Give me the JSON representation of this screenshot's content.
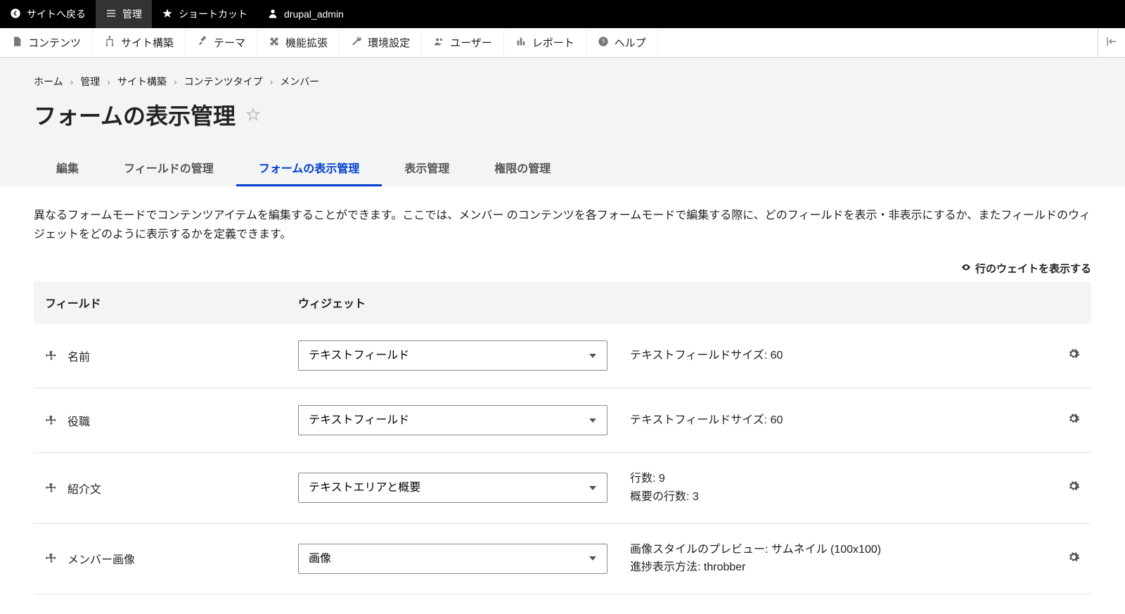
{
  "topbar": {
    "back_to_site": "サイトへ戻る",
    "manage": "管理",
    "shortcuts": "ショートカット",
    "user": "drupal_admin"
  },
  "toolbar": {
    "content": "コンテンツ",
    "structure": "サイト構築",
    "appearance": "テーマ",
    "extend": "機能拡張",
    "configuration": "環境設定",
    "people": "ユーザー",
    "reports": "レポート",
    "help": "ヘルプ"
  },
  "breadcrumb": {
    "items": [
      "ホーム",
      "管理",
      "サイト構築",
      "コンテンツタイプ",
      "メンバー"
    ]
  },
  "page_title": "フォームの表示管理",
  "tabs": {
    "edit": "編集",
    "manage_fields": "フィールドの管理",
    "manage_form_display": "フォームの表示管理",
    "manage_display": "表示管理",
    "manage_permissions": "権限の管理"
  },
  "description": "異なるフォームモードでコンテンツアイテムを編集することができます。ここでは、メンバー のコンテンツを各フォームモードで編集する際に、どのフィールドを表示・非表示にするか、またフィールドのウィジェットをどのように表示するかを定義できます。",
  "weights_toggle": "行のウェイトを表示する",
  "table": {
    "header_field": "フィールド",
    "header_widget": "ウィジェット",
    "rows": [
      {
        "label": "名前",
        "widget": "テキストフィールド",
        "summary": [
          "テキストフィールドサイズ: 60"
        ]
      },
      {
        "label": "役職",
        "widget": "テキストフィールド",
        "summary": [
          "テキストフィールドサイズ: 60"
        ]
      },
      {
        "label": "紹介文",
        "widget": "テキストエリアと概要",
        "summary": [
          "行数: 9",
          "概要の行数: 3"
        ]
      },
      {
        "label": "メンバー画像",
        "widget": "画像",
        "summary": [
          "画像スタイルのプレビュー: サムネイル (100x100)",
          "進捗表示方法: throbber"
        ]
      }
    ]
  }
}
